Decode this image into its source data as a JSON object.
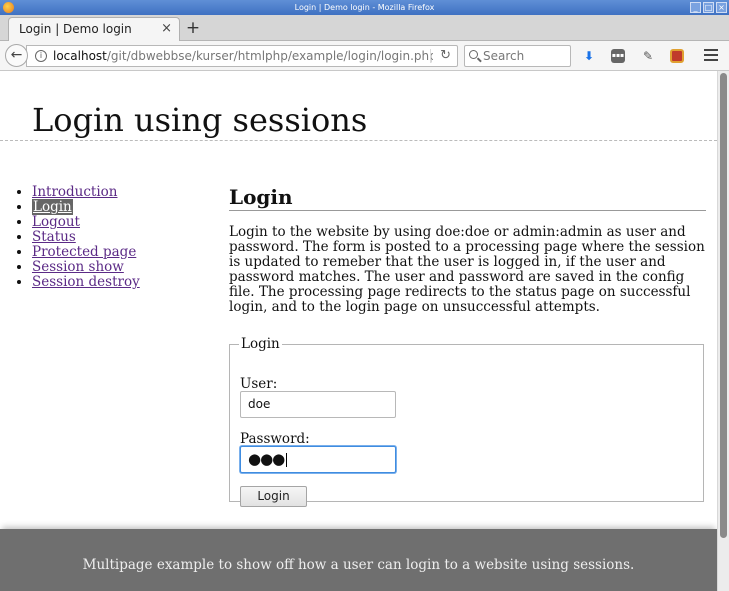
{
  "window": {
    "title": "Login | Demo login - Mozilla Firefox",
    "controls": [
      "_",
      "□",
      "×"
    ]
  },
  "tabs": [
    {
      "label": "Login | Demo login",
      "close": "×"
    }
  ],
  "new_tab_label": "+",
  "nav": {
    "back_label": "←",
    "url_host": "localhost",
    "url_path": "/git/dbwebbse/kurser/htmlphp/example/login/login.php?page=",
    "reload_label": "↻",
    "search_placeholder": "Search"
  },
  "page": {
    "site_title": "Login using sessions",
    "menu": [
      {
        "label": "Introduction",
        "selected": false
      },
      {
        "label": "Login",
        "selected": true
      },
      {
        "label": "Logout",
        "selected": false
      },
      {
        "label": "Status",
        "selected": false
      },
      {
        "label": "Protected page",
        "selected": false
      },
      {
        "label": "Session show",
        "selected": false
      },
      {
        "label": "Session destroy",
        "selected": false
      }
    ],
    "heading": "Login",
    "intro": "Login to the website by using doe:doe or admin:admin as user and password. The form is posted to a processing page where the session is updated to remeber that the user is logged in, if the user and password matches. The user and password are saved in the config file. The processing page redirects to the status page on successful login, and to the login page on unsuccessful attempts.",
    "form": {
      "legend": "Login",
      "user_label": "User:",
      "user_value": "doe",
      "password_label": "Password:",
      "password_mask": "●●●",
      "submit_label": "Login"
    },
    "footer": "Multipage example to show off how a user can login to a website using sessions."
  },
  "colors": {
    "link": "#5b2a86",
    "selected_bg": "#666666",
    "footer_bg": "#6f6f6f",
    "focus_border": "#3f8ce0"
  }
}
